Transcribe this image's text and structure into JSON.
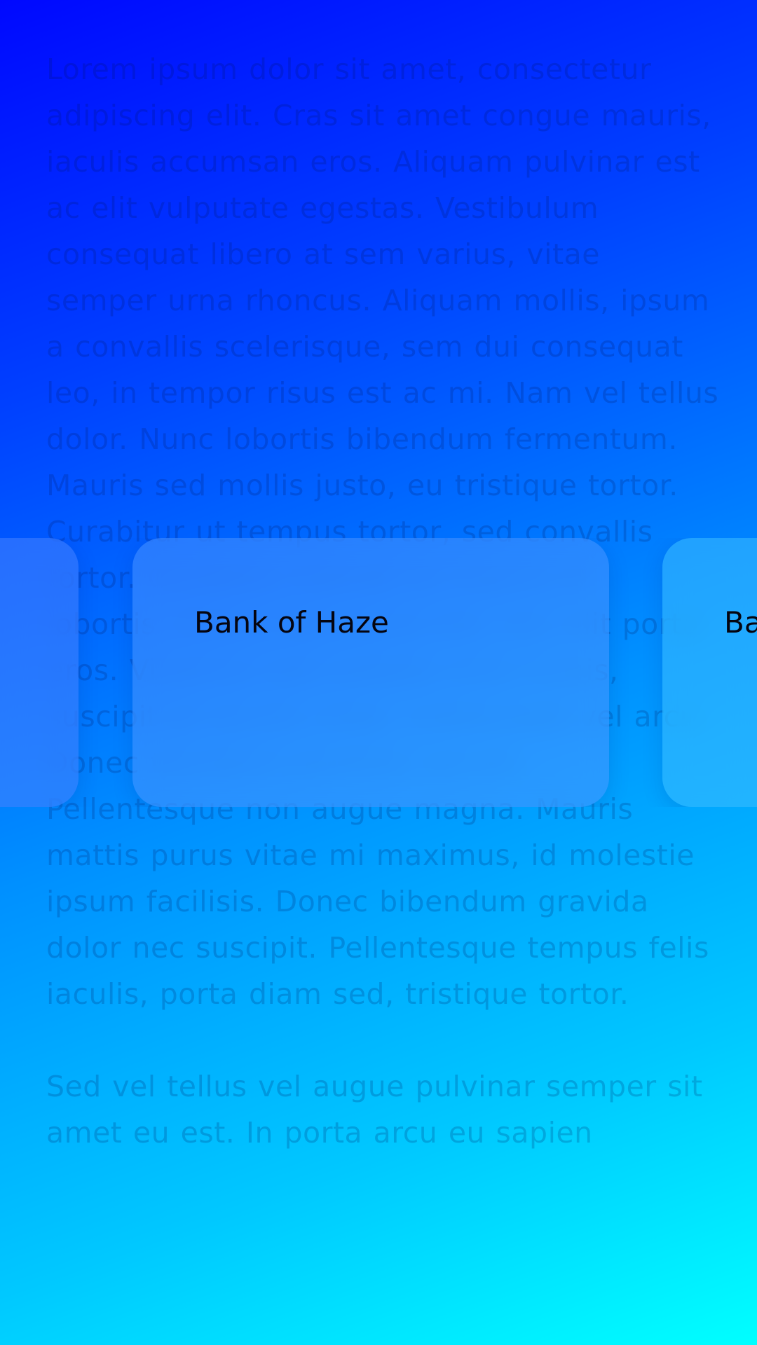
{
  "background_text": {
    "paragraph_1": "Lorem ipsum dolor sit amet, consectetur adipiscing elit. Cras sit amet congue mauris, iaculis accumsan eros. Aliquam pulvinar est ac elit vulputate egestas. Vestibulum consequat libero at sem varius, vitae semper urna rhoncus. Aliquam mollis, ipsum a convallis scelerisque, sem dui consequat leo, in tempor risus est ac mi. Nam vel tellus dolor. Nunc lobortis bibendum fermentum. Mauris sed mollis justo, eu tristique tortor. Curabitur ut tempus tortor, sed convallis tortor. Curabitur blandit et mauris id lobortis. Etiam sed varius est, nec elit porta eros. Vivamus sed sodales eros turpis, suscipit at iaculis vitae, malesuada vel arcu. Donec tincidunt porttitor iaculis. Pellentesque non augue magna. Mauris mattis purus vitae mi maximus, id molestie ipsum facilisis. Donec bibendum gravida dolor nec suscipit. Pellentesque tempus felis iaculis, porta diam sed, tristique tortor.",
    "paragraph_2": "Sed vel tellus vel augue pulvinar semper sit amet eu est. In porta arcu eu sapien"
  },
  "carousel": {
    "cards": [
      {
        "name": ""
      },
      {
        "name": "Bank of Haze"
      },
      {
        "name": "Ba"
      }
    ]
  },
  "colors": {
    "gradient_start": "#0008ff",
    "gradient_end": "#00ffff",
    "card_text": "#050510"
  }
}
